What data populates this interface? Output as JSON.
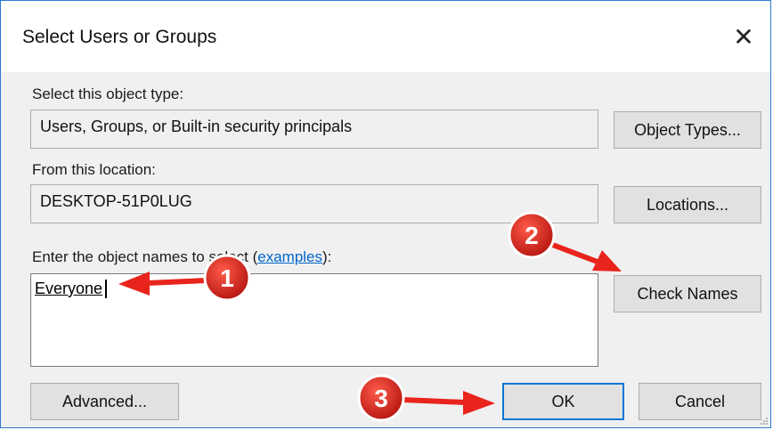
{
  "dialog": {
    "title": "Select Users or Groups",
    "close_glyph": "✕"
  },
  "object_type": {
    "label": "Select this object type:",
    "value": "Users, Groups, or Built-in security principals",
    "button": "Object Types..."
  },
  "location": {
    "label": "From this location:",
    "value": "DESKTOP-51P0LUG",
    "button": "Locations..."
  },
  "names": {
    "label_prefix": "Enter the object names to select (",
    "label_link": "examples",
    "label_suffix": "):",
    "value": "Everyone",
    "check_button": "Check Names"
  },
  "footer": {
    "advanced_button": "Advanced...",
    "ok_button": "OK",
    "cancel_button": "Cancel"
  },
  "annotations": {
    "colors": {
      "badge": "#d0221a",
      "arrow": "#e8241c"
    },
    "step1": "1",
    "step2": "2",
    "step3": "3"
  }
}
